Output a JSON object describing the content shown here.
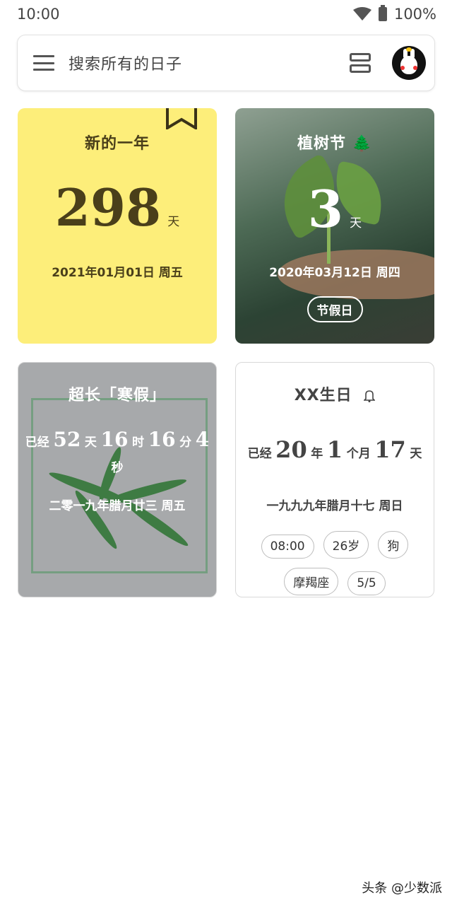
{
  "status_bar": {
    "time": "10:00",
    "battery": "100%"
  },
  "search": {
    "placeholder": "搜索所有的日子"
  },
  "cards": [
    {
      "title": "新的一年",
      "number": "298",
      "unit": "天",
      "date": "2021年01月01日 周五",
      "background": "#fdee7a"
    },
    {
      "title": "植树节 🌲",
      "number": "3",
      "unit": "天",
      "date": "2020年03月12日 周四",
      "tag": "节假日"
    },
    {
      "title": "超长「寒假」",
      "prefix": "已经",
      "days": "52",
      "days_unit": "天",
      "hours": "16",
      "hours_unit": "时",
      "minutes": "16",
      "minutes_unit": "分",
      "seconds": "4",
      "seconds_unit": "秒",
      "lunar_date": "二零一九年腊月廿三 周五"
    },
    {
      "title": "XX生日",
      "prefix": "已经",
      "years": "20",
      "years_unit": "年",
      "months": "1",
      "months_unit": "个月",
      "days": "17",
      "days_unit": "天",
      "lunar_date": "一九九九年腊月十七 周日",
      "pills": [
        "08:00",
        "26岁",
        "狗",
        "摩羯座",
        "5/5"
      ]
    }
  ],
  "watermark": "头条 @少数派"
}
